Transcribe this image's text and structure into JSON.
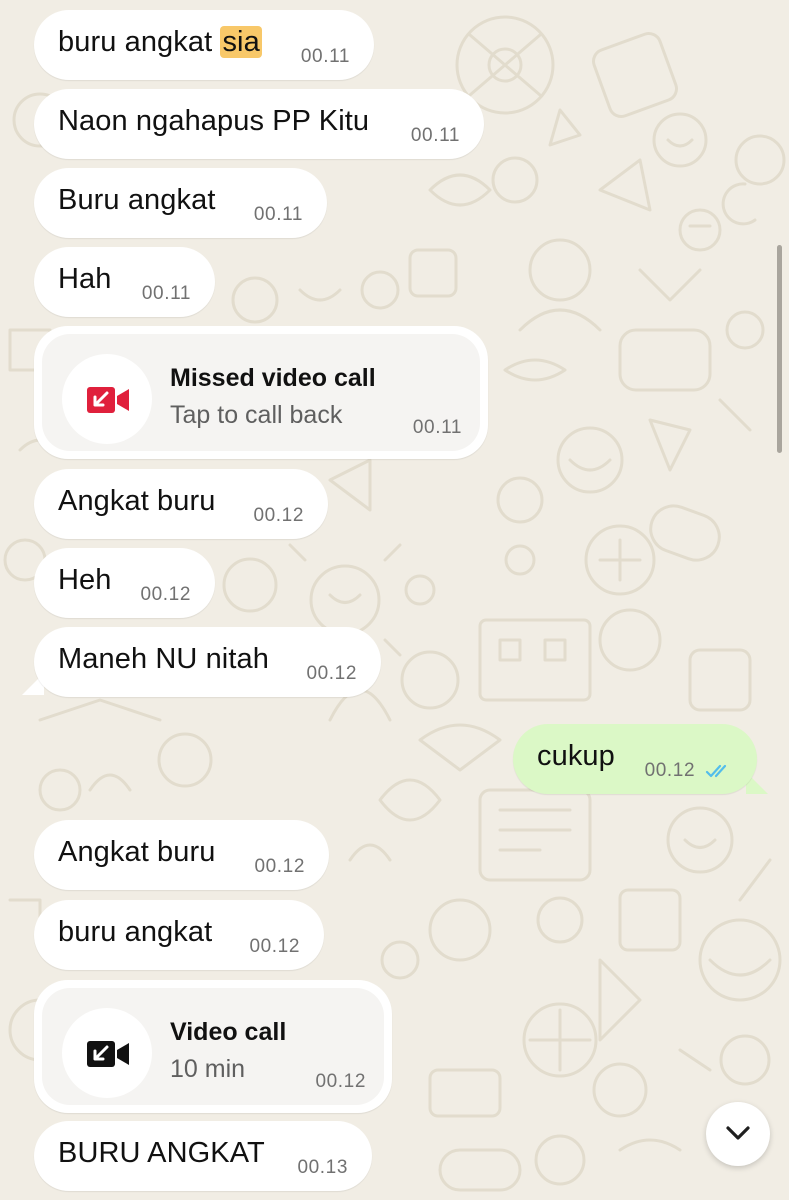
{
  "colors": {
    "background": "#f1ede4",
    "incoming_bubble": "#ffffff",
    "outgoing_bubble": "#dbf8c6",
    "missed_call_red": "#e0203c",
    "read_ticks": "#53bdeb",
    "highlight": "#f8c869"
  },
  "messages": [
    {
      "text_pre": "buru angkat ",
      "text_highlight": "sia",
      "time": "00.11"
    },
    {
      "text": "Naon ngahapus PP Kitu",
      "time": "00.11"
    },
    {
      "text": "Buru angkat",
      "time": "00.11"
    },
    {
      "text": "Hah",
      "time": "00.11"
    },
    {
      "type": "call",
      "title": "Missed video call",
      "subtitle": "Tap to call back",
      "time": "00.11",
      "icon": "missed-video-call-icon"
    },
    {
      "text": "Angkat buru",
      "time": "00.12"
    },
    {
      "text": "Heh",
      "time": "00.12"
    },
    {
      "text": "Maneh NU nitah",
      "time": "00.12"
    },
    {
      "text": "cukup",
      "time": "00.12",
      "outgoing": true,
      "status": "read"
    },
    {
      "text": "Angkat buru",
      "time": "00.12"
    },
    {
      "text": "buru angkat",
      "time": "00.12"
    },
    {
      "type": "call",
      "title": "Video call",
      "subtitle": "10 min",
      "time": "00.12",
      "icon": "video-call-icon"
    },
    {
      "text": "BURU ANGKAT",
      "time": "00.13"
    }
  ],
  "scroll_down_icon": "chevron-down-icon"
}
